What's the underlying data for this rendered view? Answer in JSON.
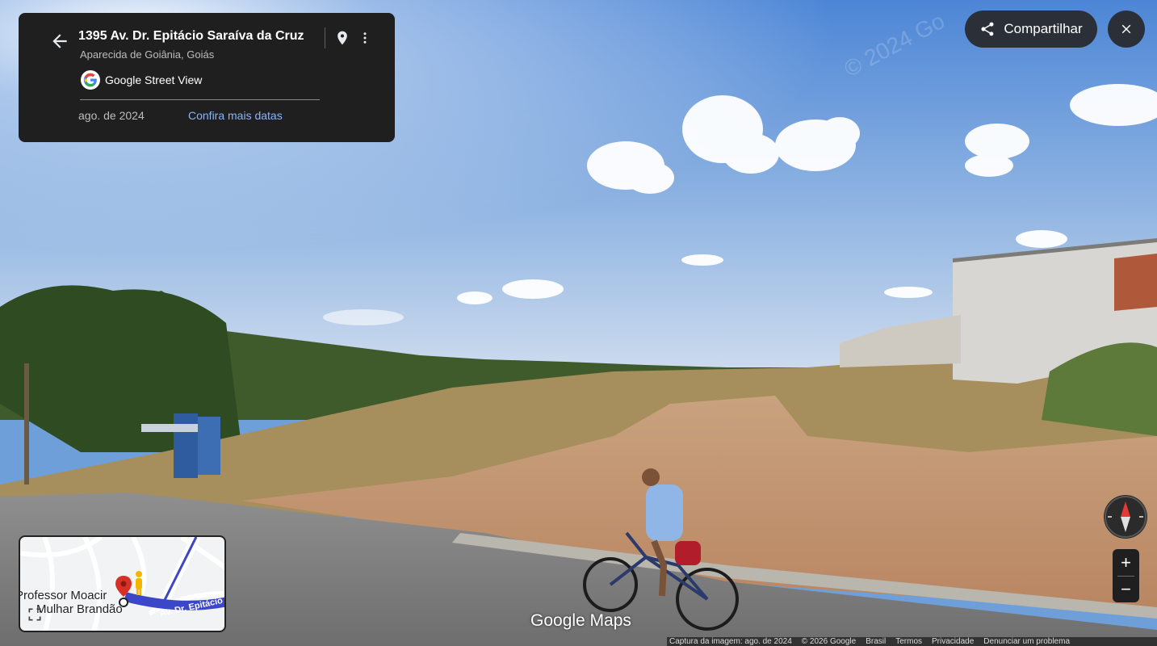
{
  "info_card": {
    "title": "1395 Av. Dr. Epitácio Saraíva da Cruz",
    "subtitle": "Aparecida de Goiânia, Goiás",
    "service_name": "Google Street View",
    "capture_date": "ago. de 2024",
    "more_dates_link": "Confira mais datas",
    "icons": {
      "back": "arrow-left-icon",
      "pin": "map-pin-icon",
      "more": "more-vert-icon",
      "logo": "google-g-logo"
    }
  },
  "top_right": {
    "share_label": "Compartilhar",
    "icons": {
      "share": "share-icon",
      "close": "close-icon"
    }
  },
  "minimap": {
    "label_line1": "Professor Moacir",
    "label_line2": "Mulhar Brandão",
    "road_label": "Av. Dr. Epitácio S",
    "icons": {
      "pin": "red-location-pin-icon",
      "pegman": "pegman-icon",
      "expand": "expand-icon"
    }
  },
  "controls": {
    "compass": "compass-icon",
    "zoom_in": "+",
    "zoom_out": "−"
  },
  "watermark": {
    "logo_text": "Google Maps",
    "sky_watermark": "© 2024 Go"
  },
  "footer": {
    "capture": "Captura da imagem: ago. de 2024",
    "copyright": "© 2026 Google",
    "country": "Brasil",
    "terms": "Termos",
    "privacy": "Privacidade",
    "report": "Denunciar um problema"
  },
  "colors": {
    "card_bg": "#1f1f1f",
    "link": "#8ab4f8",
    "button_bg": "#2b3038",
    "sky": "#6f9fd8"
  }
}
